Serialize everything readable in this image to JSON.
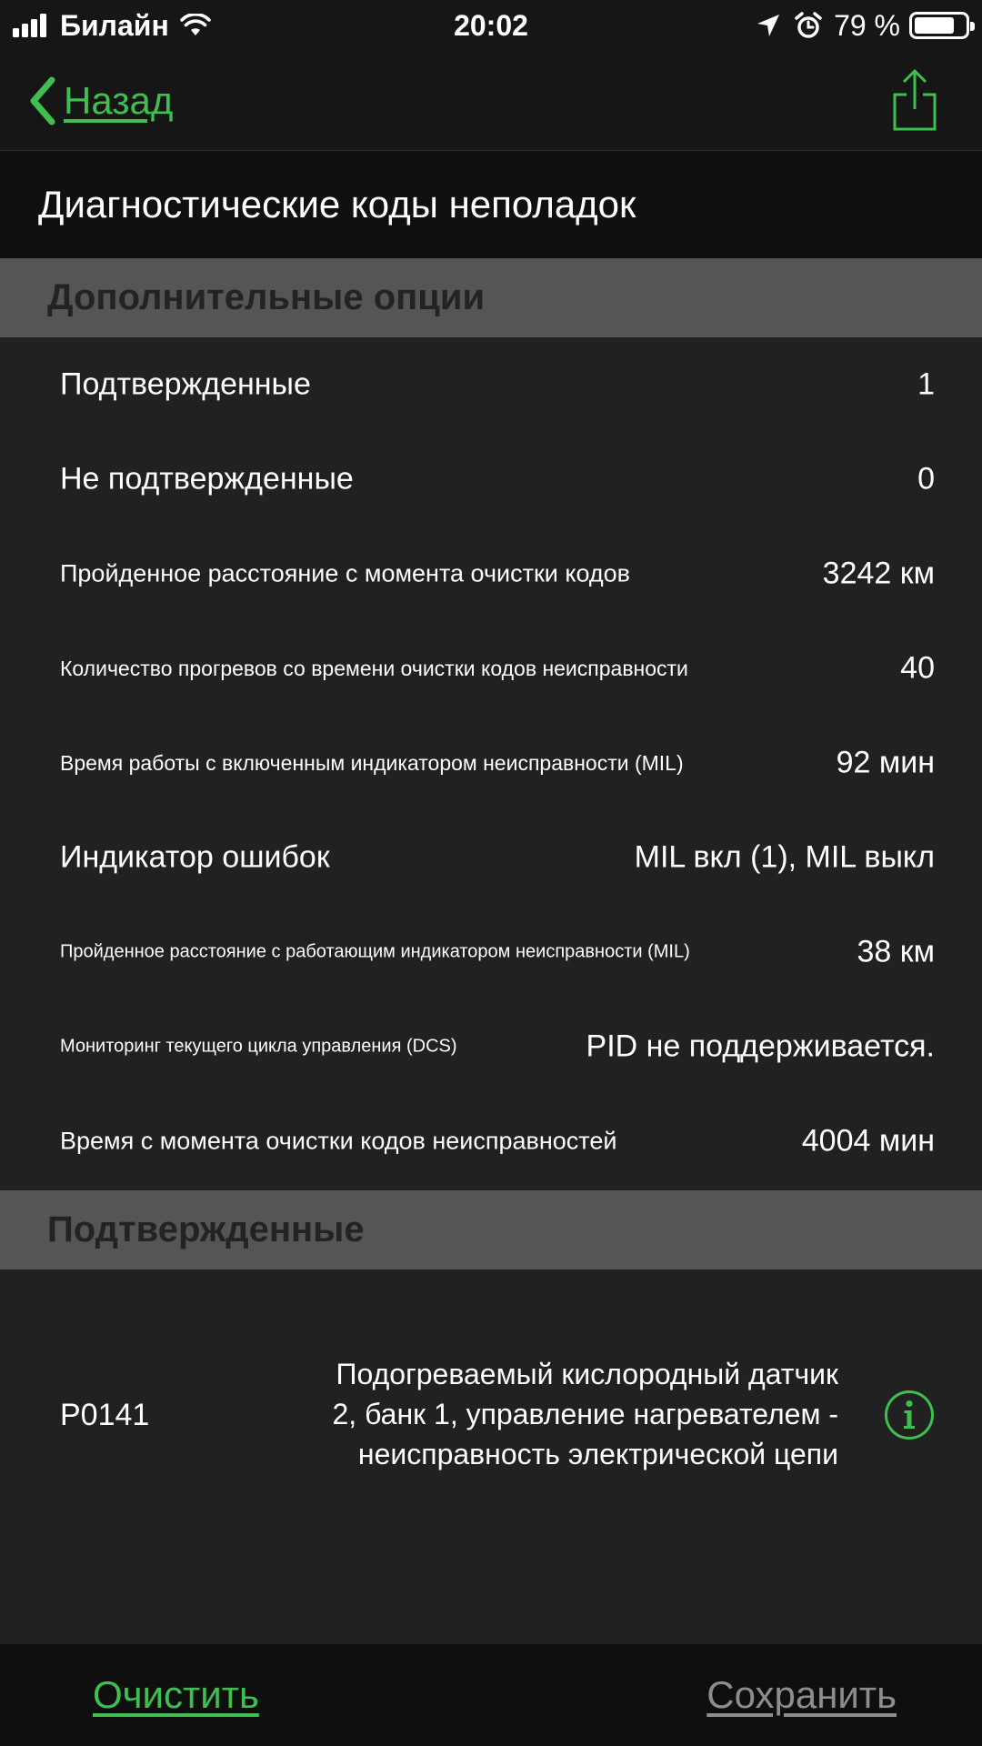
{
  "status_bar": {
    "carrier": "Билайн",
    "time": "20:02",
    "battery_percent": "79 %",
    "battery_level": 0.79,
    "icons": [
      "signal-icon",
      "wifi-icon",
      "location-icon",
      "alarm-icon",
      "battery-icon"
    ]
  },
  "nav": {
    "back_label": "Назад",
    "share_icon": "share-icon"
  },
  "page_title": "Диагностические коды неполадок",
  "sections": {
    "options": "Дополнительные опции",
    "confirmed": "Подтвержденные"
  },
  "rows": [
    {
      "label": "Подтвержденные",
      "value": "1"
    },
    {
      "label": "Не подтвержденные",
      "value": "0"
    },
    {
      "label": "Пройденное расстояние с момента очистки кодов",
      "value": "3242 км"
    },
    {
      "label": "Количество прогревов со времени очистки кодов неисправности",
      "value": "40"
    },
    {
      "label": "Время работы с включенным индикатором неисправности (MIL)",
      "value": "92 мин"
    },
    {
      "label": "Индикатор ошибок",
      "value": "MIL вкл (1), MIL выкл"
    },
    {
      "label": "Пройденное расстояние с работающим индикатором неисправности (MIL)",
      "value": "38 км"
    },
    {
      "label": "Мониторинг текущего цикла управления (DCS)",
      "value": "PID не поддерживается."
    },
    {
      "label": "Время с момента очистки кодов неисправностей",
      "value": "4004 мин"
    }
  ],
  "dtc": {
    "code": "P0141",
    "description_lines": [
      "Подогреваемый кислородный датчик",
      "2, банк 1, управление нагревателем -",
      "неисправность электрической цепи"
    ],
    "info_icon": "info-icon"
  },
  "bottom": {
    "clear_label": "Очистить",
    "save_label": "Сохранить"
  },
  "colors": {
    "accent": "#3fbf50",
    "background": "#212121",
    "section_header": "#555555",
    "bar": "#161616",
    "disabled_text": "#8d8d8d"
  }
}
